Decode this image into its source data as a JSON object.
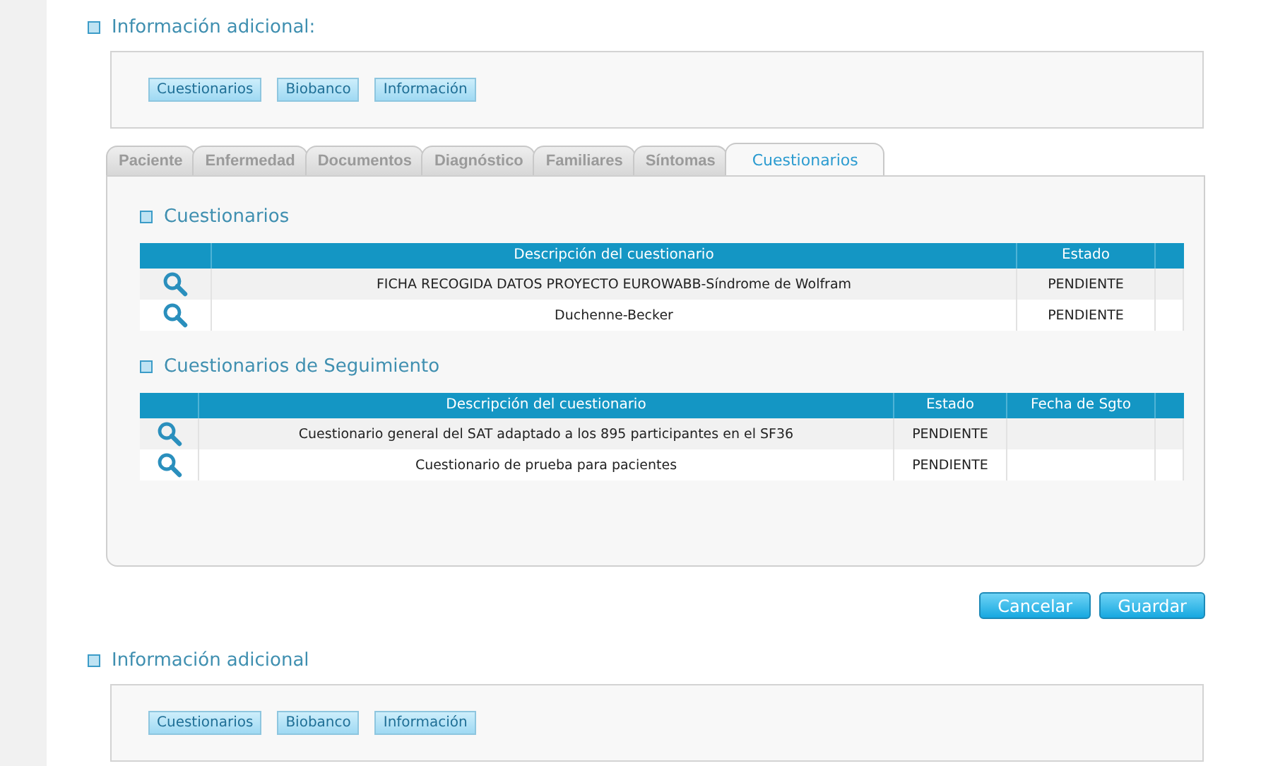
{
  "top_section": {
    "title": "Información adicional:",
    "buttons": [
      "Cuestionarios",
      "Biobanco",
      "Información"
    ]
  },
  "tabs": [
    {
      "label": "Paciente",
      "selected": false
    },
    {
      "label": "Enfermedad",
      "selected": false
    },
    {
      "label": "Documentos",
      "selected": false
    },
    {
      "label": "Diagnóstico",
      "selected": false
    },
    {
      "label": "Familiares",
      "selected": false
    },
    {
      "label": "Síntomas",
      "selected": false
    },
    {
      "label": "Cuestionarios",
      "selected": true
    }
  ],
  "tables": [
    {
      "title": "Cuestionarios",
      "columns": [
        "Descripción del cuestionario",
        "Estado"
      ],
      "rows": [
        {
          "cells": [
            "FICHA RECOGIDA DATOS PROYECTO EUROWABB-Síndrome de Wolfram",
            "PENDIENTE"
          ]
        },
        {
          "cells": [
            "Duchenne-Becker",
            "PENDIENTE"
          ]
        }
      ]
    },
    {
      "title": "Cuestionarios de Seguimiento",
      "columns": [
        "Descripción del cuestionario",
        "Estado",
        "Fecha de Sgto"
      ],
      "rows": [
        {
          "cells": [
            "Cuestionario general del SAT adaptado a los 895 participantes en el SF36",
            "PENDIENTE"
          ]
        },
        {
          "cells": [
            "Cuestionario de prueba para pacientes",
            "PENDIENTE"
          ]
        }
      ]
    }
  ],
  "actions": [
    "Cancelar",
    "Guardar"
  ],
  "bottom_section": {
    "title": "Información adicional",
    "buttons": [
      "Cuestionarios",
      "Biobanco",
      "Información"
    ]
  }
}
